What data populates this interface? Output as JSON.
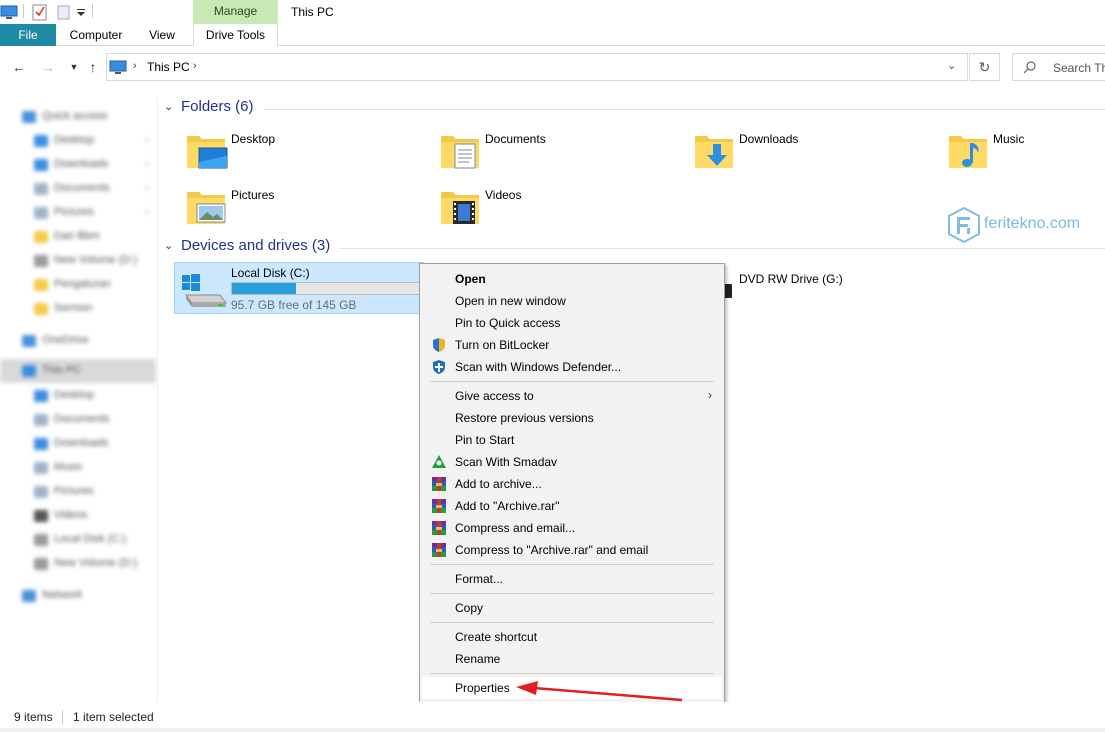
{
  "window": {
    "title": "This PC",
    "manage_tab": "Manage"
  },
  "ribbon": {
    "tabs": [
      "File",
      "Computer",
      "View",
      "Drive Tools"
    ]
  },
  "address": {
    "path": "This PC",
    "search_placeholder": "Search Th"
  },
  "sidebar": {
    "items": [
      {
        "label": "Quick access",
        "icon": "star-icon",
        "color": "#4a90d9"
      },
      {
        "label": "Desktop",
        "icon": "desktop-icon",
        "color": "#3b8de0"
      },
      {
        "label": "Downloads",
        "icon": "downloads-icon",
        "color": "#3b8de0"
      },
      {
        "label": "Documents",
        "icon": "documents-icon",
        "color": "#9fb3c8"
      },
      {
        "label": "Pictures",
        "icon": "pictures-icon",
        "color": "#9fb3c8"
      },
      {
        "label": "Dari Bbm",
        "icon": "folder-icon",
        "color": "#f3c948"
      },
      {
        "label": "New Volume (D:)",
        "icon": "drive-icon",
        "color": "#9a9a9a"
      },
      {
        "label": "Pengaturan",
        "icon": "folder-icon",
        "color": "#f3c948"
      },
      {
        "label": "Sermon",
        "icon": "folder-icon",
        "color": "#f3c948"
      },
      {
        "label": "OneDrive",
        "icon": "cloud-icon",
        "color": "#4a90d9"
      },
      {
        "label": "This PC",
        "icon": "pc-icon",
        "color": "#3b8de0"
      },
      {
        "label": "Desktop",
        "icon": "desktop-icon",
        "color": "#3b8de0"
      },
      {
        "label": "Documents",
        "icon": "documents-icon",
        "color": "#9fb3c8"
      },
      {
        "label": "Downloads",
        "icon": "downloads-icon",
        "color": "#3b8de0"
      },
      {
        "label": "Music",
        "icon": "music-icon",
        "color": "#9fb3c8"
      },
      {
        "label": "Pictures",
        "icon": "pictures-icon",
        "color": "#9fb3c8"
      },
      {
        "label": "Videos",
        "icon": "videos-icon",
        "color": "#555555"
      },
      {
        "label": "Local Disk (C:)",
        "icon": "drive-icon",
        "color": "#9a9a9a"
      },
      {
        "label": "New Volume (D:)",
        "icon": "drive-icon",
        "color": "#9a9a9a"
      },
      {
        "label": "Network",
        "icon": "network-icon",
        "color": "#4a90d9"
      }
    ]
  },
  "folders": {
    "header": "Folders (6)",
    "items": [
      {
        "name": "Desktop",
        "icon": "desktop-folder-icon"
      },
      {
        "name": "Documents",
        "icon": "documents-folder-icon"
      },
      {
        "name": "Downloads",
        "icon": "downloads-folder-icon"
      },
      {
        "name": "Music",
        "icon": "music-folder-icon"
      },
      {
        "name": "Pictures",
        "icon": "pictures-folder-icon"
      },
      {
        "name": "Videos",
        "icon": "videos-folder-icon"
      }
    ]
  },
  "devices": {
    "header": "Devices and drives (3)",
    "local_disk": {
      "name": "Local Disk (C:)",
      "free_text": "95.7 GB free of 145 GB",
      "used_fraction": 0.34
    },
    "dvd": {
      "name": "DVD RW Drive (G:)"
    }
  },
  "watermark": {
    "text": "feritekno.com"
  },
  "context_menu": {
    "items": [
      {
        "label": "Open",
        "bold": true
      },
      {
        "label": "Open in new window"
      },
      {
        "label": "Pin to Quick access"
      },
      {
        "label": "Turn on BitLocker",
        "icon": "shield-icon"
      },
      {
        "label": "Scan with Windows Defender...",
        "icon": "defender-icon"
      },
      {
        "label": "Give access to",
        "submenu": true
      },
      {
        "label": "Restore previous versions"
      },
      {
        "label": "Pin to Start"
      },
      {
        "label": "Scan With Smadav",
        "icon": "smadav-icon"
      },
      {
        "label": "Add to archive...",
        "icon": "winrar-icon"
      },
      {
        "label": "Add to \"Archive.rar\"",
        "icon": "winrar-icon"
      },
      {
        "label": "Compress and email...",
        "icon": "winrar-icon"
      },
      {
        "label": "Compress to \"Archive.rar\" and email",
        "icon": "winrar-icon"
      },
      {
        "label": "Format..."
      },
      {
        "label": "Copy"
      },
      {
        "label": "Create shortcut"
      },
      {
        "label": "Rename"
      },
      {
        "label": "Properties"
      }
    ]
  },
  "status": {
    "count": "9 items",
    "selected": "1 item selected"
  },
  "colors": {
    "accent": "#1e8aa3",
    "selection": "#cce8ff",
    "header_text": "#1e3287",
    "annotation_arrow": "#e02020"
  }
}
